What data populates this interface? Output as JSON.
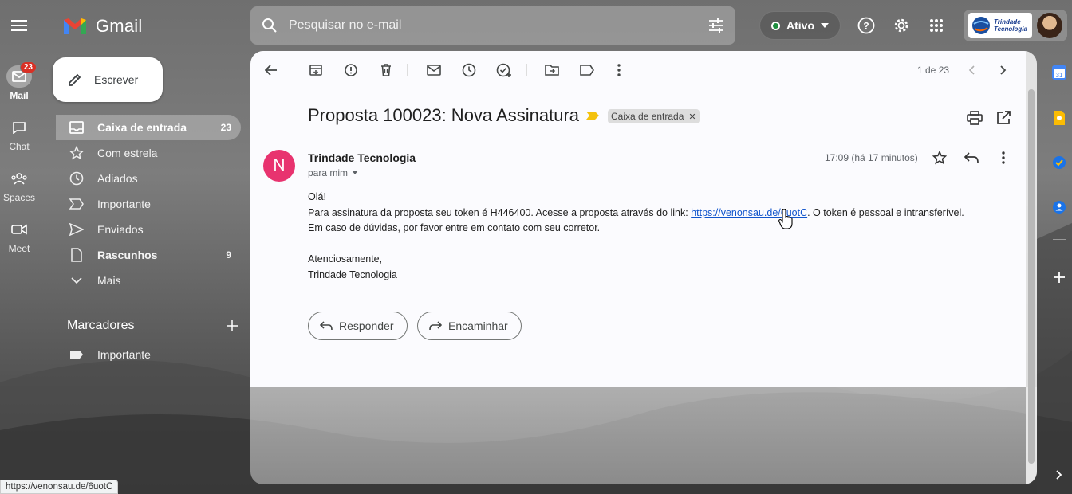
{
  "app": {
    "name": "Gmail"
  },
  "rail": {
    "items": [
      {
        "label": "Mail",
        "badge": "23"
      },
      {
        "label": "Chat"
      },
      {
        "label": "Spaces"
      },
      {
        "label": "Meet"
      }
    ]
  },
  "search": {
    "placeholder": "Pesquisar no e-mail"
  },
  "status": {
    "label": "Ativo",
    "color": "#1e8e3e"
  },
  "account": {
    "org_line1": "Trindade",
    "org_line2": "Tecnologia"
  },
  "compose": {
    "label": "Escrever"
  },
  "nav": {
    "items": [
      {
        "label": "Caixa de entrada",
        "count": "23",
        "icon": "inbox-icon"
      },
      {
        "label": "Com estrela",
        "icon": "star-icon"
      },
      {
        "label": "Adiados",
        "icon": "clock-icon"
      },
      {
        "label": "Importante",
        "icon": "label-important-icon"
      },
      {
        "label": "Enviados",
        "icon": "send-icon"
      },
      {
        "label": "Rascunhos",
        "count": "9",
        "icon": "draft-icon"
      },
      {
        "label": "Mais",
        "icon": "chevron-down-icon"
      }
    ]
  },
  "labels": {
    "header": "Marcadores",
    "items": [
      {
        "label": "Importante"
      }
    ]
  },
  "toolbar": {
    "pager": "1 de 23"
  },
  "email": {
    "subject": "Proposta 100023: Nova Assinatura",
    "label_chip": "Caixa de entrada",
    "sender_initial": "N",
    "sender_name": "Trindade Tecnologia",
    "recipient": "para mim",
    "timestamp": "17:09 (há 17 minutos)",
    "greeting": "Olá!",
    "line1_before": "Para assinatura da proposta seu token é H446400. Acesse a proposta através do link: ",
    "link": "https://venonsau.de/6uotC",
    "line1_after": ". O token é pessoal e intransferível.",
    "line2": "Em caso de dúvidas, por favor entre em contato com seu corretor.",
    "closing": "Atenciosamente,",
    "signature": "Trindade Tecnologia",
    "avatar_color": "#e8336f"
  },
  "actions": {
    "reply": "Responder",
    "forward": "Encaminhar"
  },
  "statusbar": {
    "url": "https://venonsau.de/6uotC"
  }
}
